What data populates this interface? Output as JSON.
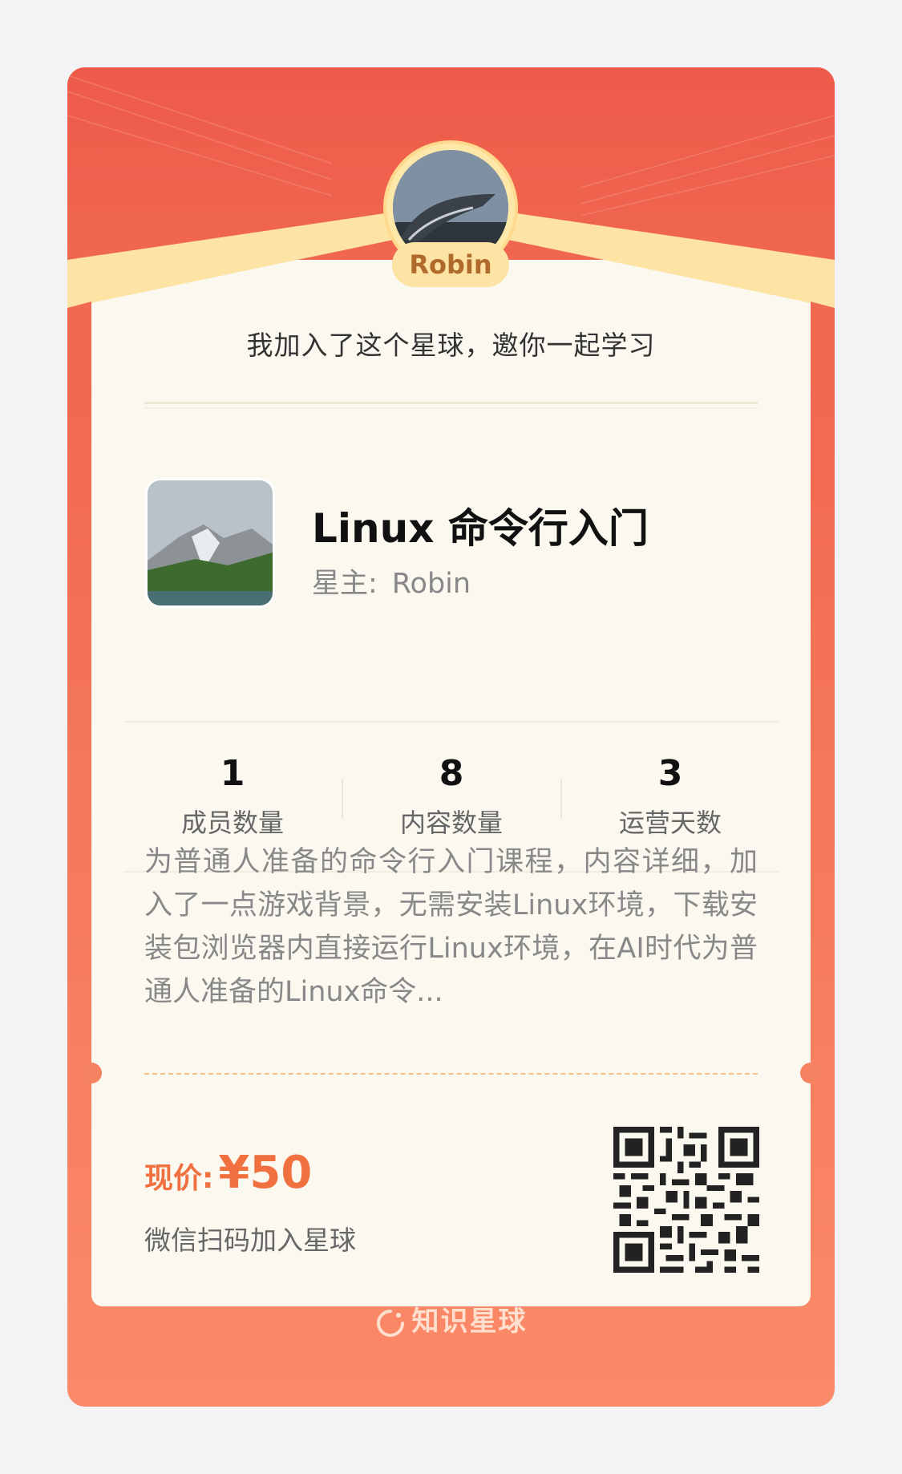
{
  "user": {
    "name": "Robin"
  },
  "invite_text": "我加入了这个星球，邀你一起学习",
  "group": {
    "title": "Linux 命令行入门",
    "owner_label": "星主:",
    "owner_name": "Robin"
  },
  "stats": [
    {
      "value": "1",
      "label": "成员数量"
    },
    {
      "value": "8",
      "label": "内容数量"
    },
    {
      "value": "3",
      "label": "运营天数"
    }
  ],
  "description": "为普通人准备的命令行入门课程，内容详细，加入了一点游戏背景，无需安装Linux环境，下载安装包浏览器内直接运行Linux环境，在AI时代为普通人准备的Linux命令...",
  "price": {
    "label": "现价:",
    "value": "¥50"
  },
  "scan_text": "微信扫码加入星球",
  "footer": {
    "brand": "知识星球"
  },
  "colors": {
    "accent": "#f07040",
    "card_top": "#ee5c4b",
    "card_bottom": "#fb8a68",
    "panel": "#fbf8ef",
    "ribbon": "#fde4a5"
  }
}
